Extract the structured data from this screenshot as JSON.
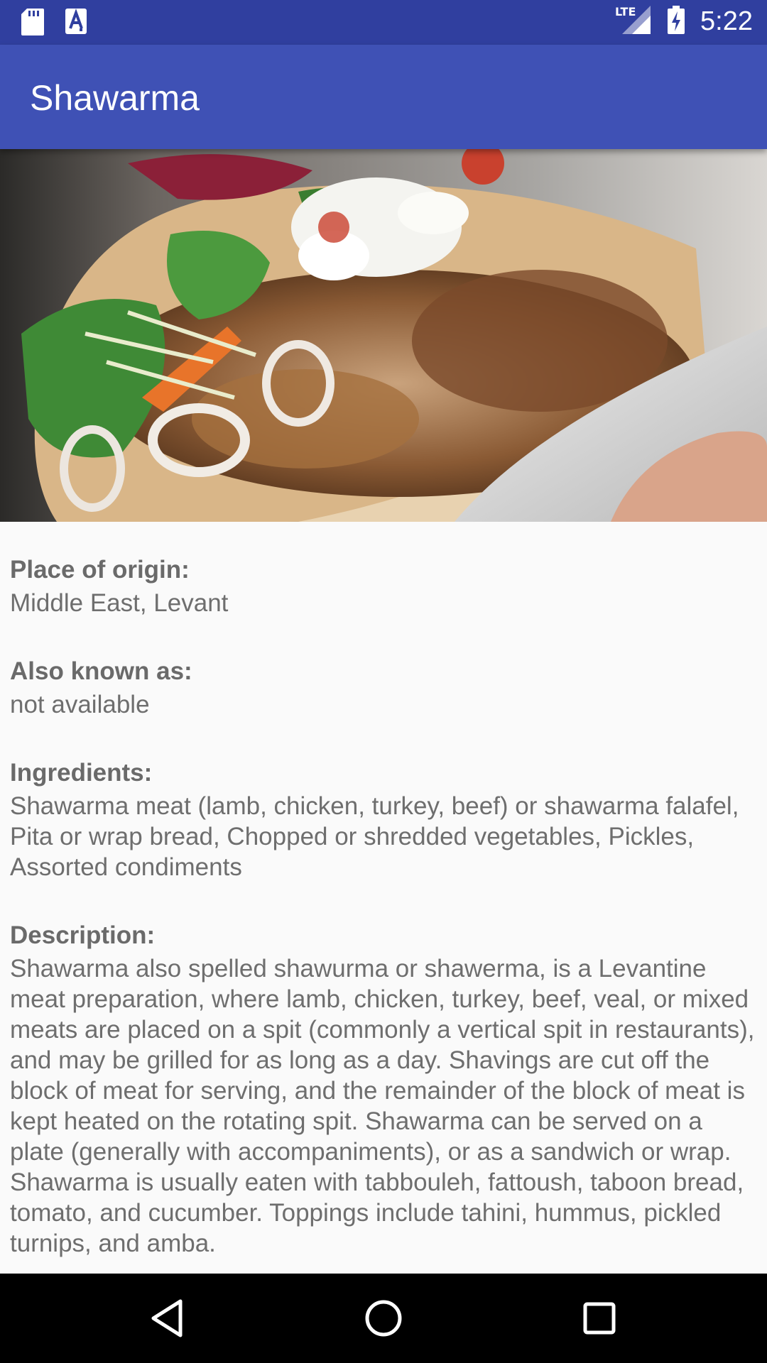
{
  "status_bar": {
    "time": "5:22",
    "network": "LTE",
    "icons": [
      "sd-card-icon",
      "a-icon",
      "lte-signal-icon",
      "battery-charging-icon"
    ]
  },
  "app_bar": {
    "title": "Shawarma"
  },
  "hero_image": {
    "subject": "shawarma wrap"
  },
  "details": {
    "origin_label": "Place of origin:",
    "origin_value": "Middle East, Levant",
    "aka_label": "Also known as:",
    "aka_value": "not available",
    "ingredients_label": "Ingredients:",
    "ingredients_value": "Shawarma meat (lamb, chicken, turkey, beef) or shawarma falafel, Pita or wrap bread, Chopped or shredded vegetables, Pickles, Assorted condiments",
    "description_label": "Description:",
    "description_value": "Shawarma also spelled shawurma or shawerma, is a Levantine meat preparation, where lamb, chicken, turkey, beef, veal, or mixed meats are placed on a spit (commonly a vertical spit in restaurants), and may be grilled for as long as a day. Shavings are cut off the block of meat for serving, and the remainder of the block of meat is kept heated on the rotating spit. Shawarma can be served on a plate (generally with accompaniments), or as a sandwich or wrap. Shawarma is usually eaten with tabbouleh, fattoush, taboon bread, tomato, and cucumber. Toppings include tahini, hummus, pickled turnips, and amba."
  },
  "nav_bar": {
    "icons": [
      "back-icon",
      "home-icon",
      "recents-icon"
    ]
  },
  "colors": {
    "status_bar": "#303f9f",
    "app_bar": "#3f51b5",
    "background": "#fafafa",
    "text": "#6e6e6e"
  }
}
